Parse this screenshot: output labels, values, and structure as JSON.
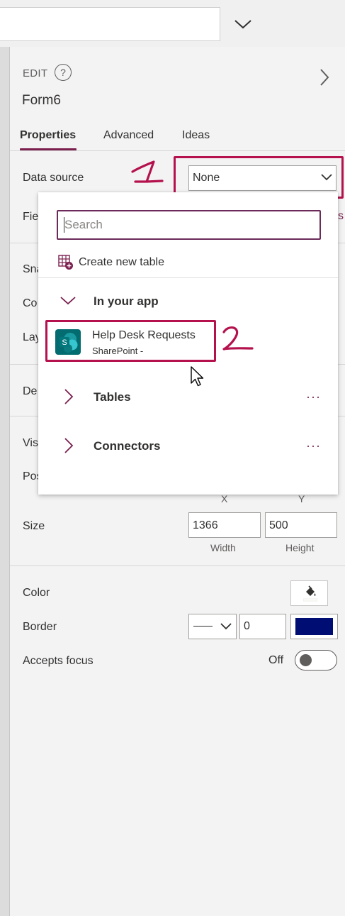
{
  "header": {
    "edit_label": "EDIT",
    "help_glyph": "?",
    "control_name": "Form6",
    "tabs": [
      "Properties",
      "Advanced",
      "Ideas"
    ]
  },
  "properties": {
    "data_source_label": "Data source",
    "data_source_value": "None",
    "fields_label_clipped": "Fie",
    "fields_edit_clipped": "s",
    "snap_label_clipped": "Sna",
    "columns_label_clipped": "Co",
    "layout_label_clipped": "Lay",
    "default_mode_label_clipped": "De",
    "visible_label_clipped": "Vis",
    "position_label_clipped": "Pos",
    "size_label": "Size",
    "x_label": "X",
    "y_label": "Y",
    "width_value": "1366",
    "height_value": "500",
    "width_label": "Width",
    "height_label": "Height",
    "color_label": "Color",
    "border_label": "Border",
    "border_width_value": "0",
    "border_color": "#000e73",
    "accepts_focus_label": "Accepts focus",
    "accepts_focus_state": "Off"
  },
  "dropdown": {
    "search_placeholder": "Search",
    "create_new_table": "Create new table",
    "groups": [
      {
        "label": "In your app",
        "expanded": true
      },
      {
        "label": "Tables",
        "expanded": false,
        "more": "···"
      },
      {
        "label": "Connectors",
        "expanded": false,
        "more": "···"
      }
    ],
    "items": [
      {
        "title": "Help Desk Requests",
        "subtitle": "SharePoint -",
        "icon": "sharepoint-icon"
      }
    ]
  },
  "annotations": {
    "marker_1": "1",
    "marker_2": "2",
    "color": "#b4114d"
  },
  "theme": {
    "accent": "#7a1f4e",
    "search_border": "#6b2a59",
    "sharepoint": "#03787c"
  }
}
